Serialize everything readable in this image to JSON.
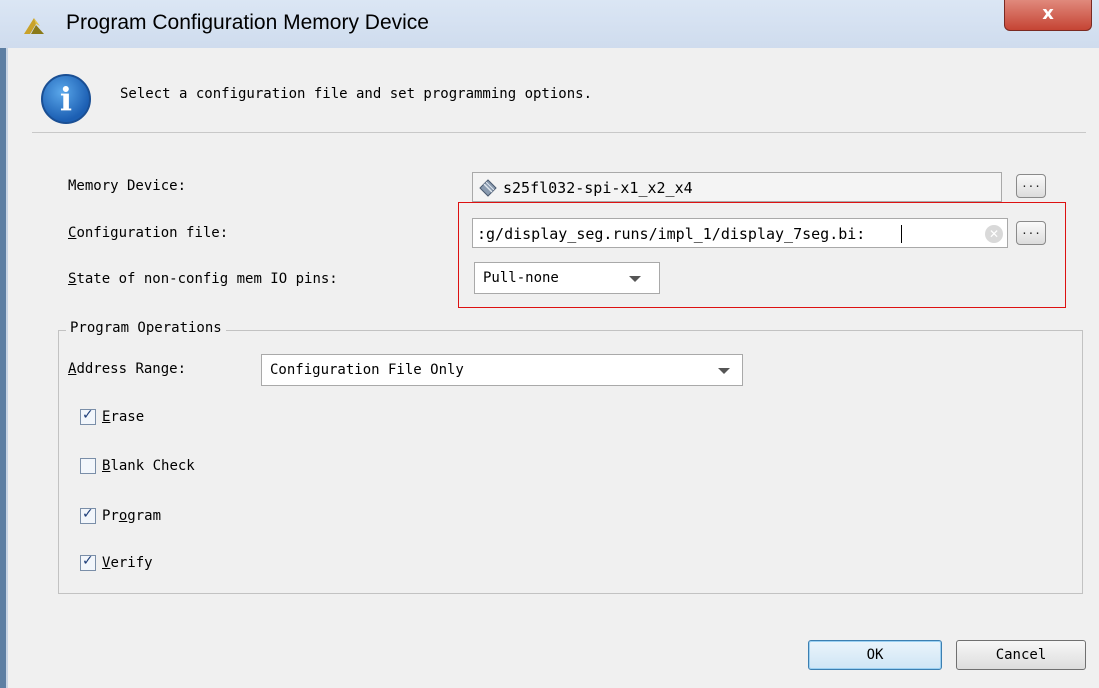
{
  "window": {
    "title": "Program Configuration Memory Device",
    "close_glyph": "x"
  },
  "header": {
    "message": "Select a configuration file and set programming options."
  },
  "fields": {
    "memory_device": {
      "label": "Memory Device:",
      "value": "s25fl032-spi-x1_x2_x4",
      "browse": "..."
    },
    "config_file": {
      "label_prefix": "C",
      "label_rest": "onfiguration file:",
      "value": ":g/display_seg.runs/impl_1/display_7seg.bi:",
      "browse": "..."
    },
    "io_pins": {
      "label_prefix": "S",
      "label_rest": "tate of non-config mem IO pins:",
      "value": "Pull-none"
    }
  },
  "program_operations": {
    "title": "Program Operations",
    "address_range": {
      "label_prefix": "A",
      "label_rest": "ddress Range:",
      "value": "Configuration File Only"
    },
    "options": [
      {
        "prefix": "E",
        "rest": "rase",
        "checked": true
      },
      {
        "prefix": "B",
        "rest": "lank Check",
        "checked": false
      },
      {
        "prefix": "Pr",
        "underline": "o",
        "rest": "gram",
        "checked": true
      },
      {
        "prefix": "V",
        "rest": "erify",
        "checked": true
      }
    ]
  },
  "buttons": {
    "ok": "OK",
    "cancel": "Cancel"
  },
  "colors": {
    "highlight": "#dd1111",
    "info_blue": "#1c5fb3"
  }
}
